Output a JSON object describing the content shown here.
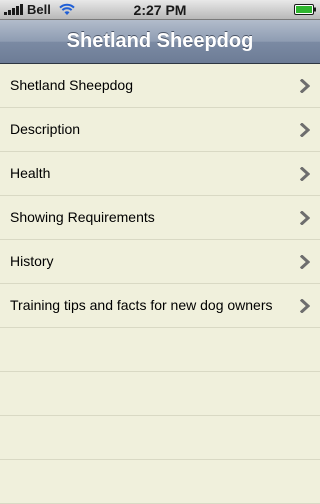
{
  "status_bar": {
    "carrier": "Bell",
    "time": "2:27 PM"
  },
  "nav": {
    "title": "Shetland Sheepdog"
  },
  "menu": {
    "items": [
      {
        "label": "Shetland Sheepdog"
      },
      {
        "label": "Description"
      },
      {
        "label": "Health"
      },
      {
        "label": "Showing Requirements"
      },
      {
        "label": "History"
      },
      {
        "label": "Training tips and facts for new dog owners"
      }
    ]
  },
  "colors": {
    "background": "#f0f0dc",
    "separator": "#d9d9c4",
    "nav_bar": "#8e9cb2",
    "chevron": "#6e6e6e"
  },
  "icons": {
    "disclosure": "chevron-right-icon",
    "signal": "signal-strength-icon",
    "wifi": "wifi-icon",
    "battery": "battery-icon"
  }
}
